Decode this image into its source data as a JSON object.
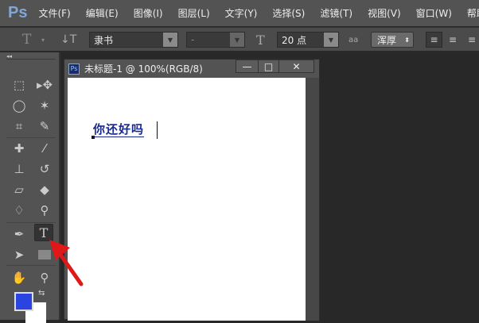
{
  "app": {
    "logo": "Ps"
  },
  "menu": [
    "文件(F)",
    "编辑(E)",
    "图像(I)",
    "图层(L)",
    "文字(Y)",
    "选择(S)",
    "滤镜(T)",
    "视图(V)",
    "窗口(W)",
    "帮助(H)"
  ],
  "options": {
    "tool_icon": "T",
    "font_family": "隶书",
    "font_style": "-",
    "font_size": "20 点",
    "antialias": "浑厚",
    "aa_icon": "aa"
  },
  "document": {
    "title": "未标题-1 @ 100%(RGB/8)",
    "text": "你还好吗",
    "minimize": "—",
    "maximize": "□",
    "close": "✕"
  },
  "colors": {
    "foreground": "#2a44e0",
    "background": "#ffffff",
    "annotation_arrow": "#e01818"
  },
  "toolbar": {
    "collapse": "◂◂",
    "active_tool": "type-tool"
  }
}
